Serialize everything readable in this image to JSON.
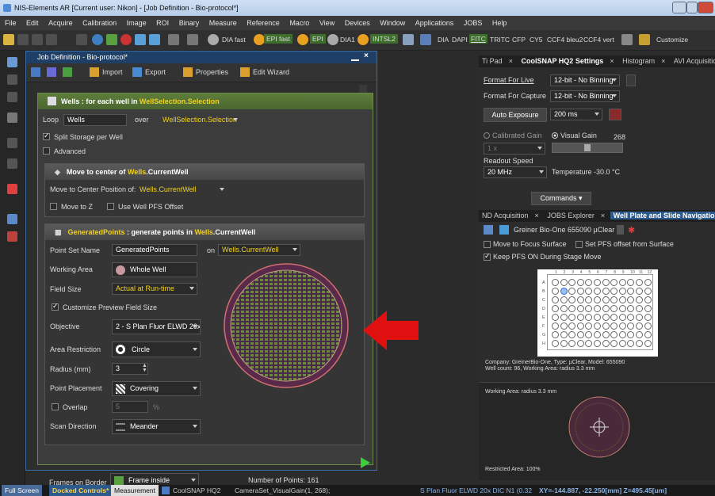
{
  "window": {
    "title": "NIS-Elements AR [Current user: Nikon] - [Job Definition - Bio-protocol*]"
  },
  "menu": [
    "File",
    "Edit",
    "Acquire",
    "Calibration",
    "Image",
    "ROI",
    "Binary",
    "Measure",
    "Reference",
    "Macro",
    "View",
    "Devices",
    "Window",
    "Applications",
    "JOBS",
    "Help"
  ],
  "toolbar": {
    "dia_fast": "DIA fast",
    "epi_fast": "EPI fast",
    "epi": "EPI",
    "dia1": "DIA1",
    "intsl2": "INTSL2",
    "filters": [
      "DIA",
      "DAPI",
      "FITC",
      "TRITC",
      "CFP",
      "CY5",
      "CCF4 bleu2",
      "CCF4 vert"
    ],
    "customize": "Customize"
  },
  "job": {
    "title": "Job Definition - Bio-protocol*",
    "import": "Import",
    "export": "Export",
    "properties": "Properties",
    "edit_wizard": "Edit Wizard",
    "wells_header_a": "Wells : for each well in ",
    "wells_header_b": "WellSelection.Selection",
    "loop_label": "Loop",
    "loop_value": "Wells",
    "over_label": "over",
    "over_value": "WellSelection.Selection",
    "split_storage": "Split Storage per Well",
    "advanced": "Advanced",
    "move_header_a": "Move to center of ",
    "move_header_b": "Wells",
    ".": "",
    "move_header_c": ".CurrentWell",
    "move_pos_label": "Move to Center Position of:",
    "move_pos_value": "Wells.CurrentWell",
    "move_to_z": "Move to Z",
    "use_pfs": "Use Well PFS Offset",
    "gen_header_a": "GeneratedPoints",
    "gen_header_b": " : generate points in ",
    "gen_header_c": "Wells",
    "gen_header_d": ".CurrentWell",
    "point_set_label": "Point Set Name",
    "point_set_value": "GeneratedPoints",
    "on_label": "on",
    "on_value": "Wells.CurrentWell",
    "working_area_label": "Working Area",
    "working_area_value": "Whole Well",
    "field_size_label": "Field Size",
    "field_size_value": "Actual at Run-time",
    "customize_preview": "Customize Preview Field Size",
    "objective_label": "Objective",
    "objective_value": "2 - S Plan Fluor ELWD 20x",
    "area_restriction_label": "Area Restriction",
    "area_restriction_value": "Circle",
    "radius_label": "Radius (mm)",
    "radius_value": "3",
    "point_placement_label": "Point Placement",
    "point_placement_value": "Covering",
    "overlap_label": "Overlap",
    "overlap_value": "5",
    "overlap_unit": "%",
    "scan_direction_label": "Scan Direction",
    "scan_direction_value": "Meander",
    "frames_border_label": "Frames on Border",
    "frames_border_value": "Frame inside",
    "num_points": "Number of Points: 161"
  },
  "right": {
    "tabs1": [
      "Ti Pad",
      "CoolSNAP HQ2 Settings",
      "Histogram",
      "AVI Acquisition"
    ],
    "format_live_label": "Format For Live",
    "format_live_value": "12-bit - No Binning",
    "format_capture_label": "Format For Capture",
    "format_capture_value": "12-bit - No Binning",
    "auto_exposure": "Auto Exposure",
    "exposure_value": "200 ms",
    "calibrated_gain": "Calibrated Gain",
    "visual_gain": "Visual Gain",
    "gain_value": "268",
    "gain_x": "1 x",
    "readout_label": "Readout Speed",
    "readout_value": "20 MHz",
    "temperature": "Temperature -30.0 °C",
    "commands": "Commands",
    "tabs2": [
      "ND Acquisition",
      "JOBS Explorer",
      "Well Plate and Slide Navigation"
    ],
    "plate_name": "Greiner Bio-One 655090 µClear",
    "move_focus": "Move to Focus Surface",
    "set_pfs": "Set PFS offset from Surface",
    "keep_pfs": "Keep PFS ON During Stage Move",
    "cols": [
      "1",
      "2",
      "3",
      "4",
      "5",
      "6",
      "7",
      "8",
      "9",
      "10",
      "11",
      "12"
    ],
    "rows": [
      "A",
      "B",
      "C",
      "D",
      "E",
      "F",
      "G",
      "H"
    ],
    "company_line1": "Company: GreinerBio-One, Type: µClear, Model: 655090",
    "company_line2": "Well count: 96, Working Area: radius 3.3 mm",
    "working_area_caption": "Working Area: radius 3.3 mm",
    "restricted_area": "Restricted Area: 100%"
  },
  "status": {
    "tabs": [
      "Full Screen",
      "Docked Controls*",
      "Measurement"
    ],
    "camera": "CoolSNAP HQ2",
    "cameraset": "CameraSet_VisualGain(1, 268);",
    "objective": "S Plan Fluor ELWD 20x DIC N1 (0.32",
    "coords": "XY=-144.887, -22.250[mm]  Z=495.45[um]"
  },
  "colors": {
    "arrow": "#e01010",
    "accent_yellow": "#f2d21f",
    "panel_green": "#5f7e3b",
    "selection_blue": "#2d5a8d"
  }
}
